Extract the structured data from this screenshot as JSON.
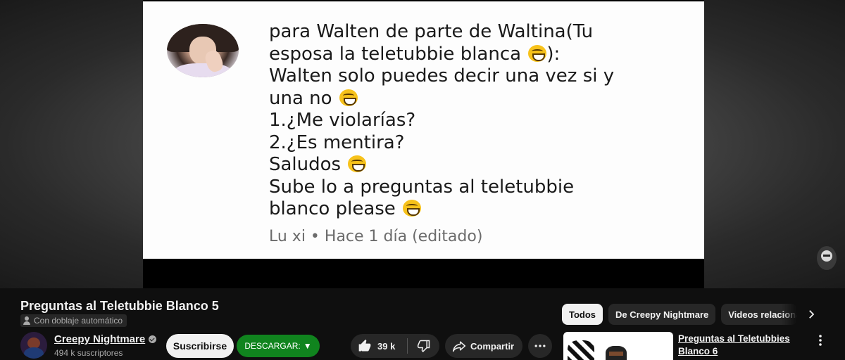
{
  "player": {
    "comment_lines": [
      {
        "text": "para Walten de parte de Waltina(Tu",
        "emoji": false,
        "suffix": ""
      },
      {
        "text": "esposa la teletubbie blanca ",
        "emoji": true,
        "suffix": "):"
      },
      {
        "text": "Walten solo puedes decir una vez si y",
        "emoji": false,
        "suffix": ""
      },
      {
        "text": "una no ",
        "emoji": true,
        "suffix": ""
      },
      {
        "text": "1.¿Me violarías?",
        "emoji": false,
        "suffix": ""
      },
      {
        "text": "2.¿Es mentira?",
        "emoji": false,
        "suffix": ""
      },
      {
        "text": "Saludos ",
        "emoji": true,
        "suffix": ""
      },
      {
        "text": "Sube lo a preguntas al teletubbie",
        "emoji": false,
        "suffix": ""
      },
      {
        "text": "blanco please ",
        "emoji": true,
        "suffix": ""
      }
    ],
    "comment_meta": "Lu xi • Hace 1 día (editado)",
    "emoji_icon": "grinning-face-icon"
  },
  "video": {
    "title": "Preguntas al Teletubbie Blanco 5",
    "dub_label": "Con doblaje automático"
  },
  "channel": {
    "name": "Creepy Nightmare",
    "subscribers": "494 k suscriptores",
    "subscribe_label": "Suscribirse",
    "download_label": "DESCARGAR:",
    "download_arrow": "▼"
  },
  "actions": {
    "likes": "39 k",
    "share_label": "Compartir"
  },
  "chips": [
    "Todos",
    "De Creepy Nightmare",
    "Videos relacionados"
  ],
  "recommendation": {
    "title": "Preguntas al Teletubbies Blanco 6"
  },
  "colors": {
    "background": "#0f0f0f",
    "download_button": "#10841e",
    "pill": "#272727"
  }
}
